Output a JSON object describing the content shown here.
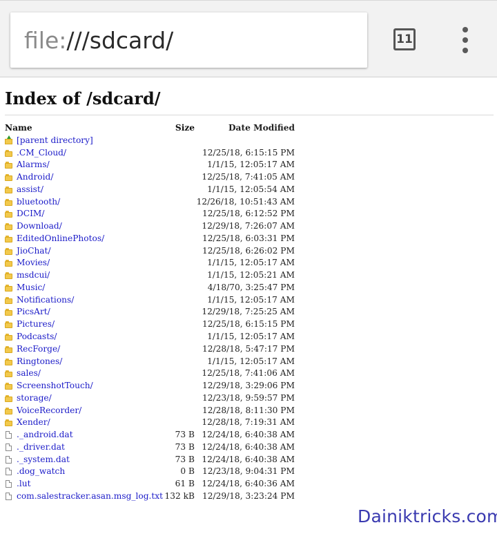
{
  "browser": {
    "url_scheme": "file:",
    "url_path": "///sdcard/",
    "tab_count": "11"
  },
  "page": {
    "title": "Index of /sdcard/"
  },
  "columns": {
    "name": "Name",
    "size": "Size",
    "date": "Date Modified"
  },
  "parent_link": "[parent directory]",
  "entries": [
    {
      "type": "folder",
      "name": ".CM_Cloud/",
      "size": "",
      "date": "12/25/18, 6:15:15 PM"
    },
    {
      "type": "folder",
      "name": "Alarms/",
      "size": "",
      "date": "1/1/15, 12:05:17 AM"
    },
    {
      "type": "folder",
      "name": "Android/",
      "size": "",
      "date": "12/25/18, 7:41:05 AM"
    },
    {
      "type": "folder",
      "name": "assist/",
      "size": "",
      "date": "1/1/15, 12:05:54 AM"
    },
    {
      "type": "folder",
      "name": "bluetooth/",
      "size": "",
      "date": "12/26/18, 10:51:43 AM"
    },
    {
      "type": "folder",
      "name": "DCIM/",
      "size": "",
      "date": "12/25/18, 6:12:52 PM"
    },
    {
      "type": "folder",
      "name": "Download/",
      "size": "",
      "date": "12/29/18, 7:26:07 AM"
    },
    {
      "type": "folder",
      "name": "EditedOnlinePhotos/",
      "size": "",
      "date": "12/25/18, 6:03:31 PM"
    },
    {
      "type": "folder",
      "name": "JioChat/",
      "size": "",
      "date": "12/25/18, 6:26:02 PM"
    },
    {
      "type": "folder",
      "name": "Movies/",
      "size": "",
      "date": "1/1/15, 12:05:17 AM"
    },
    {
      "type": "folder",
      "name": "msdcui/",
      "size": "",
      "date": "1/1/15, 12:05:21 AM"
    },
    {
      "type": "folder",
      "name": "Music/",
      "size": "",
      "date": "4/18/70, 3:25:47 PM"
    },
    {
      "type": "folder",
      "name": "Notifications/",
      "size": "",
      "date": "1/1/15, 12:05:17 AM"
    },
    {
      "type": "folder",
      "name": "PicsArt/",
      "size": "",
      "date": "12/29/18, 7:25:25 AM"
    },
    {
      "type": "folder",
      "name": "Pictures/",
      "size": "",
      "date": "12/25/18, 6:15:15 PM"
    },
    {
      "type": "folder",
      "name": "Podcasts/",
      "size": "",
      "date": "1/1/15, 12:05:17 AM"
    },
    {
      "type": "folder",
      "name": "RecForge/",
      "size": "",
      "date": "12/28/18, 5:47:17 PM"
    },
    {
      "type": "folder",
      "name": "Ringtones/",
      "size": "",
      "date": "1/1/15, 12:05:17 AM"
    },
    {
      "type": "folder",
      "name": "sales/",
      "size": "",
      "date": "12/25/18, 7:41:06 AM"
    },
    {
      "type": "folder",
      "name": "ScreenshotTouch/",
      "size": "",
      "date": "12/29/18, 3:29:06 PM"
    },
    {
      "type": "folder",
      "name": "storage/",
      "size": "",
      "date": "12/23/18, 9:59:57 PM"
    },
    {
      "type": "folder",
      "name": "VoiceRecorder/",
      "size": "",
      "date": "12/28/18, 8:11:30 PM"
    },
    {
      "type": "folder",
      "name": "Xender/",
      "size": "",
      "date": "12/28/18, 7:19:31 AM"
    },
    {
      "type": "file",
      "name": "._android.dat",
      "size": "73 B",
      "date": "12/24/18, 6:40:38 AM"
    },
    {
      "type": "file",
      "name": "._driver.dat",
      "size": "73 B",
      "date": "12/24/18, 6:40:38 AM"
    },
    {
      "type": "file",
      "name": "._system.dat",
      "size": "73 B",
      "date": "12/24/18, 6:40:38 AM"
    },
    {
      "type": "file",
      "name": ".dog_watch",
      "size": "0 B",
      "date": "12/23/18, 9:04:31 PM"
    },
    {
      "type": "file",
      "name": ".lut",
      "size": "61 B",
      "date": "12/24/18, 6:40:36 AM"
    },
    {
      "type": "file",
      "name": "com.salestracker.asan.msg_log.txt",
      "size": "132 kB",
      "date": "12/29/18, 3:23:24 PM"
    }
  ],
  "watermark": "Dainiktricks.com"
}
